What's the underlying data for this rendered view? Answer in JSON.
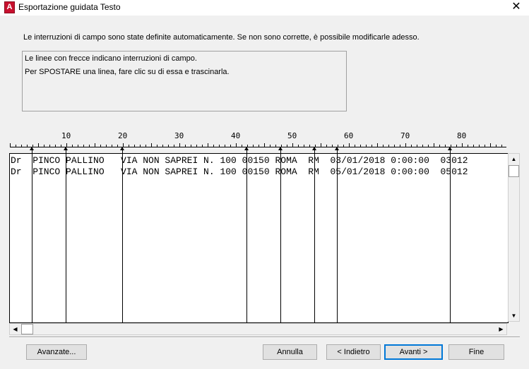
{
  "window": {
    "app_icon": "A",
    "title": "Esportazione guidata Testo",
    "close_glyph": "✕"
  },
  "instructions": "Le interruzioni di campo sono state definite automaticamente. Se non sono corrette, è possibile modificarle adesso.",
  "info_box": {
    "line1": "Le linee con frecce indicano interruzioni di campo.",
    "line2": "Per SPOSTARE una linea, fare clic su di essa e trascinarla."
  },
  "ruler": {
    "labels": [
      "10",
      "20",
      "30",
      "40",
      "50",
      "60",
      "70",
      "80"
    ]
  },
  "preview": {
    "rows": [
      "Dr  PINCO PALLINO   VIA NON SAPREI N. 100 00150 ROMA  RM  03/01/2018 0:00:00  03012",
      "Dr  PINCO PALLINO   VIA NON SAPREI N. 100 00150 ROMA  RM  05/01/2018 0:00:00  05012"
    ],
    "field_breaks": [
      4,
      10,
      20,
      42,
      48,
      54,
      58,
      78
    ]
  },
  "scrollbars": {
    "up": "▲",
    "down": "▼",
    "left": "◀",
    "right": "▶"
  },
  "buttons": {
    "advanced": "Avanzate...",
    "cancel": "Annulla",
    "back": "< Indietro",
    "next": "Avanti >",
    "finish": "Fine"
  },
  "colors": {
    "accent": "#0078d7",
    "app_icon": "#c8102e"
  }
}
